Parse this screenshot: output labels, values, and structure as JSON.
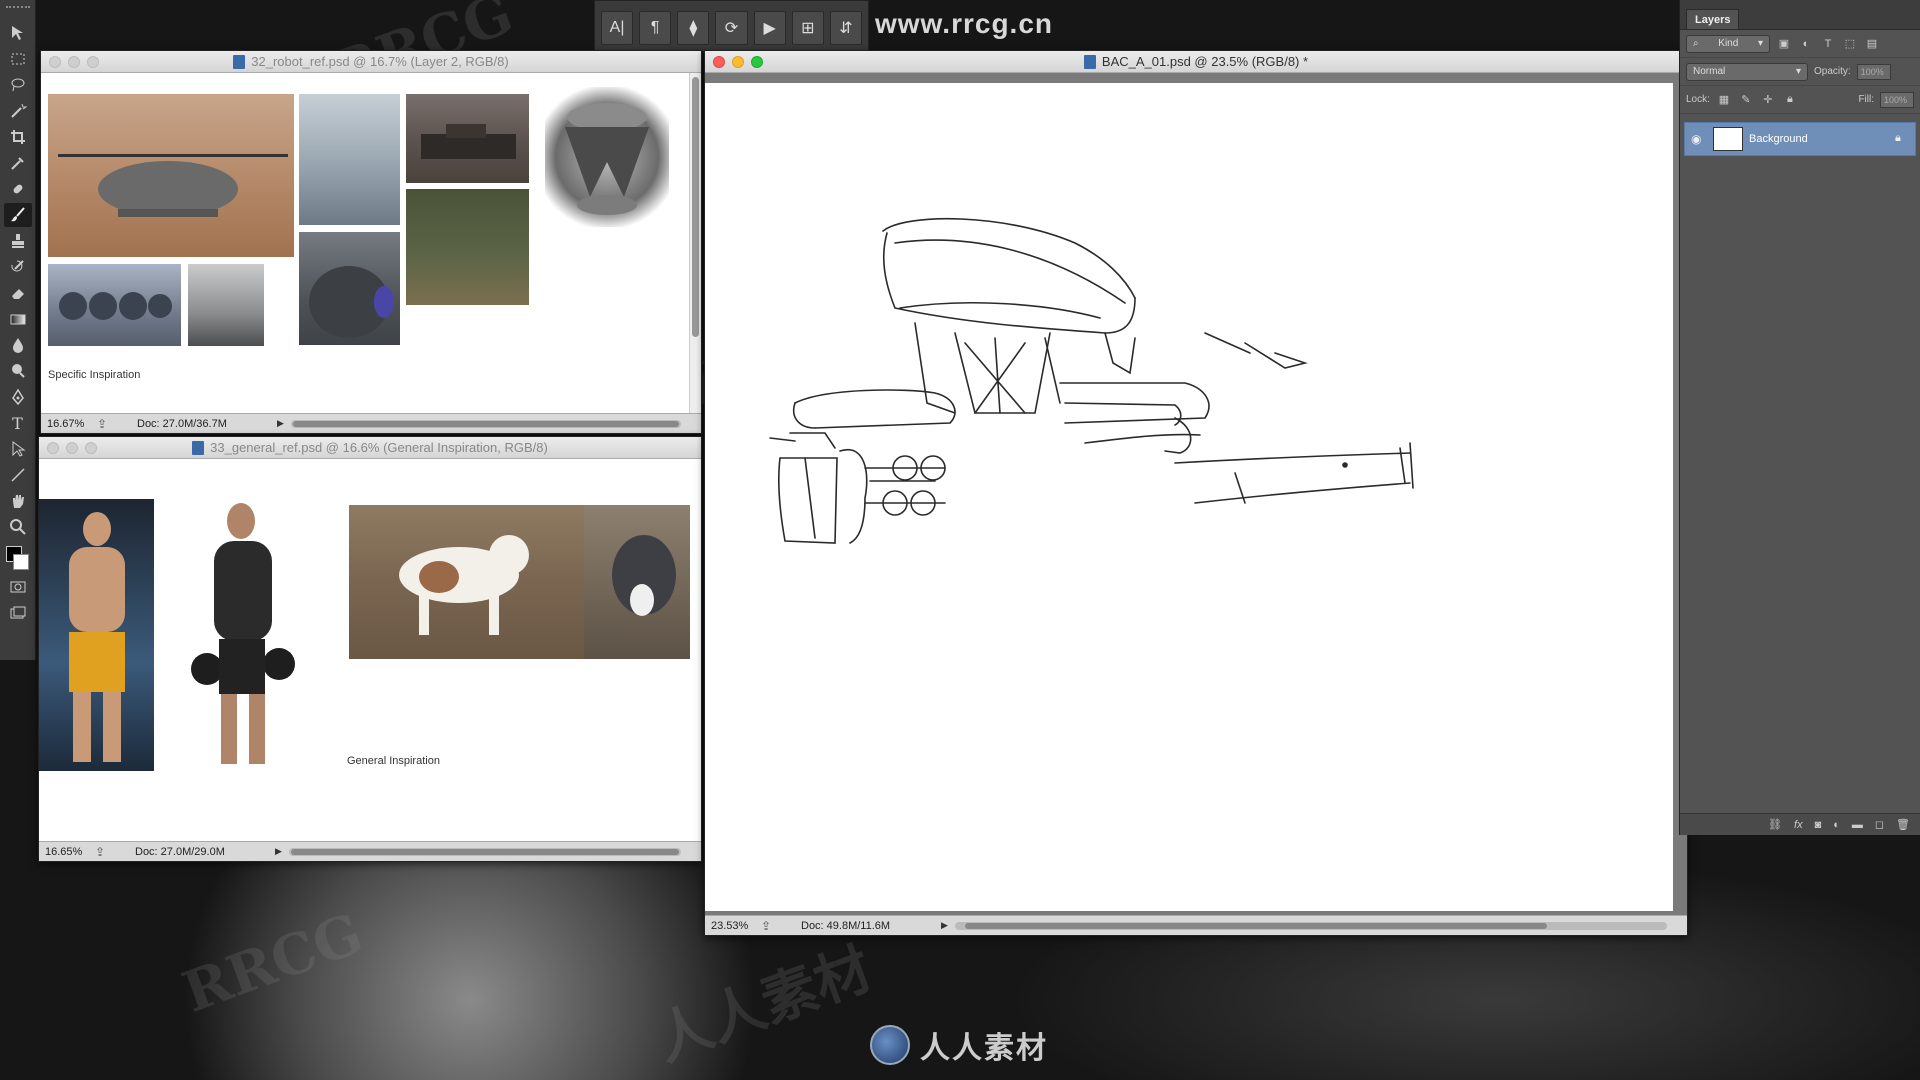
{
  "top_watermark_url": "www.rrcg.cn",
  "bottom_logo_text": "人人素材",
  "watermarks": [
    "RRCG",
    "人人素材"
  ],
  "toolbar": {
    "tools": [
      "move-icon",
      "marquee-icon",
      "lasso-icon",
      "magic-wand-icon",
      "crop-icon",
      "eyedropper-icon",
      "healing-brush-icon",
      "brush-icon",
      "clone-stamp-icon",
      "history-brush-icon",
      "eraser-icon",
      "gradient-icon",
      "blur-icon",
      "dodge-icon",
      "pen-icon",
      "type-icon",
      "path-select-icon",
      "line-icon",
      "hand-icon",
      "zoom-icon"
    ],
    "active_tool": "brush-icon"
  },
  "options_bar": {
    "buttons": [
      "A|",
      "¶",
      "⧫",
      "⟳",
      "▶",
      "⊞",
      "⇵"
    ]
  },
  "win_robot": {
    "title": "32_robot_ref.psd @ 16.7% (Layer 2, RGB/8)",
    "caption": "Specific Inspiration",
    "zoom": "16.67%",
    "doc": "Doc: 27.0M/36.7M"
  },
  "win_general": {
    "title": "33_general_ref.psd @ 16.6% (General Inspiration, RGB/8)",
    "caption": "General Inspiration",
    "zoom": "16.65%",
    "doc": "Doc: 27.0M/29.0M"
  },
  "win_main": {
    "title": "BAC_A_01.psd @ 23.5% (RGB/8) *",
    "zoom": "23.53%",
    "doc": "Doc: 49.8M/11.6M"
  },
  "layers": {
    "tab": "Layers",
    "filter": "Kind",
    "blend_mode": "Normal",
    "opacity_label": "Opacity:",
    "opacity_value": "100%",
    "lock_label": "Lock:",
    "fill_label": "Fill:",
    "fill_value": "100%",
    "items": [
      {
        "name": "Background",
        "visible": true,
        "locked": true
      }
    ],
    "footer_icons": [
      "link-icon",
      "fx-icon",
      "mask-icon",
      "adjustment-icon",
      "folder-icon",
      "new-layer-icon",
      "trash-icon"
    ]
  },
  "colors": {
    "panel_bg": "#535353",
    "selected_layer": "#6f8fb9",
    "traffic_red": "#fc5f57",
    "traffic_yellow": "#fdbc2e",
    "traffic_green": "#28c83f"
  }
}
